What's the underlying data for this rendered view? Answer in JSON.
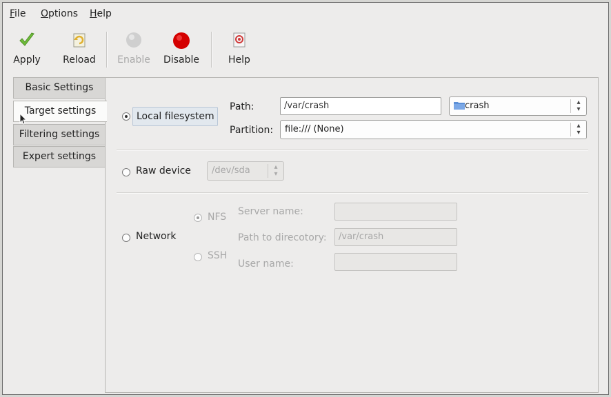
{
  "menubar": {
    "items": [
      {
        "mnemonic": "F",
        "rest": "ile"
      },
      {
        "mnemonic": "O",
        "rest": "ptions"
      },
      {
        "mnemonic": "H",
        "rest": "elp"
      }
    ]
  },
  "toolbar": {
    "apply": {
      "label": "Apply",
      "icon": "checkmark-icon",
      "enabled": true
    },
    "reload": {
      "label": "Reload",
      "icon": "reload-icon",
      "enabled": true
    },
    "enable": {
      "label": "Enable",
      "icon": "grey-circle-icon",
      "enabled": false
    },
    "disable": {
      "label": "Disable",
      "icon": "red-circle-icon",
      "enabled": true
    },
    "help": {
      "label": "Help",
      "icon": "help-icon",
      "enabled": true
    }
  },
  "tabs": [
    {
      "label": "Basic Settings",
      "active": false
    },
    {
      "label": "Target settings",
      "active": true
    },
    {
      "label": "Filtering settings",
      "active": false
    },
    {
      "label": "Expert settings",
      "active": false
    }
  ],
  "local": {
    "label": "Local filesystem",
    "selected": true,
    "path_label": "Path:",
    "path_value": "/var/crash",
    "folder_combo": "crash",
    "partition_label": "Partition:",
    "partition_value": "file:/// (None)"
  },
  "raw": {
    "label": "Raw device",
    "selected": false,
    "device_value": "/dev/sda"
  },
  "network": {
    "label": "Network",
    "selected": false,
    "nfs_label": "NFS",
    "nfs_selected": true,
    "ssh_label": "SSH",
    "ssh_selected": false,
    "server_label": "Server name:",
    "server_value": "",
    "dir_label": "Path to direcotory:",
    "dir_value": "/var/crash",
    "user_label": "User name:",
    "user_value": ""
  },
  "colors": {
    "apply_check": "#6fbd3a",
    "disable_red": "#d40000",
    "enable_grey": "#c8c8c8",
    "folder_blue": "#5b8fd6"
  }
}
